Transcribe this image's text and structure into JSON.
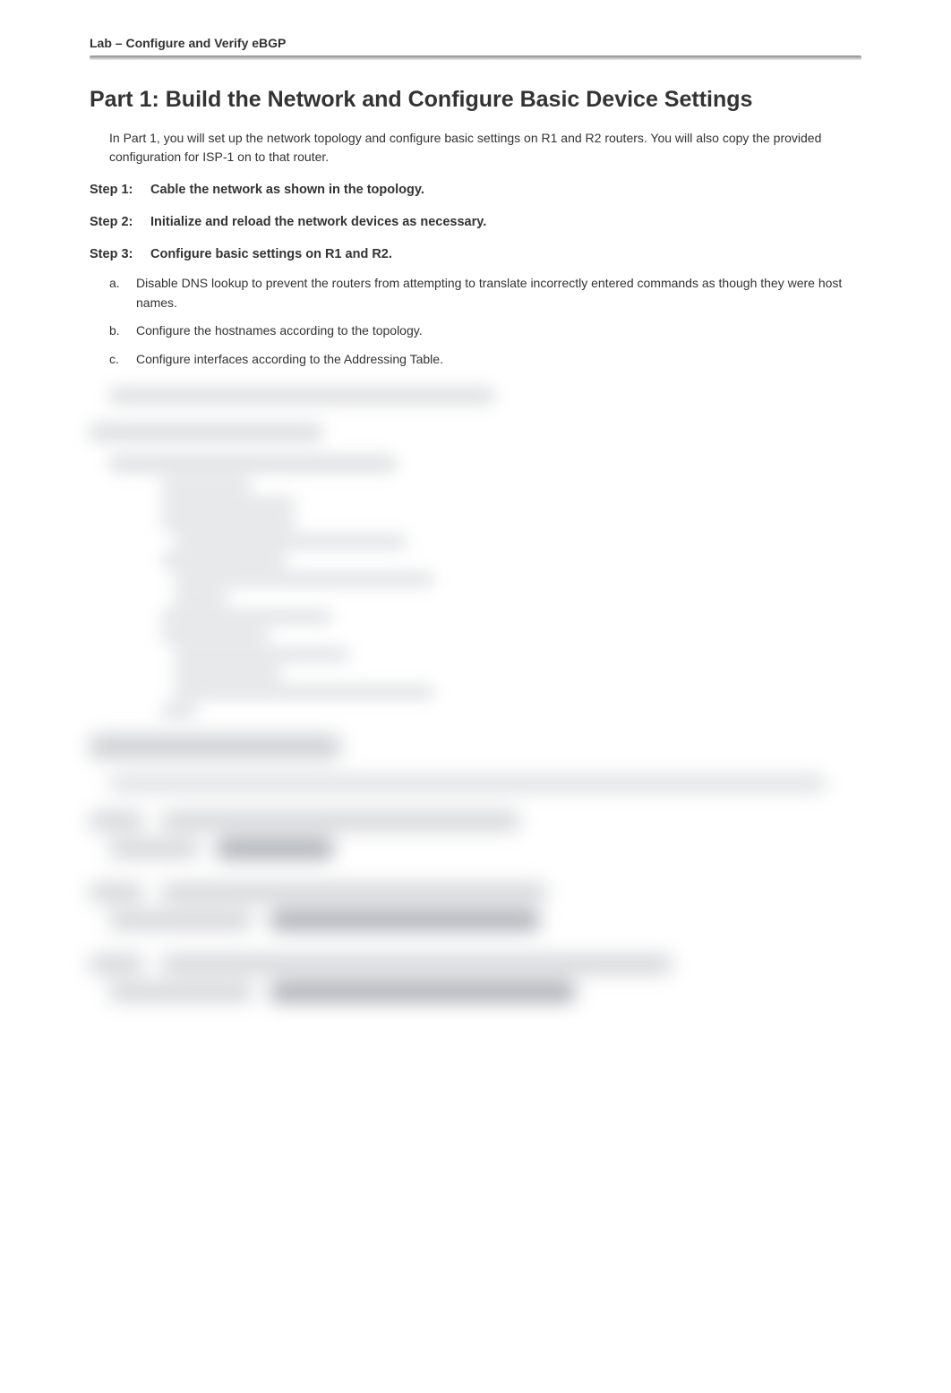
{
  "header": "Lab – Configure and Verify eBGP",
  "part1": {
    "title": "Part 1: Build the Network and Configure Basic Device Settings",
    "intro": "In Part 1, you will set up the network topology and configure basic settings on R1 and R2 routers. You will also copy the provided configuration for ISP-1 on to that router."
  },
  "steps": {
    "s1": {
      "num": "Step 1:",
      "title": "Cable the network as shown in the topology."
    },
    "s2": {
      "num": "Step 2:",
      "title": "Initialize and reload the network devices as necessary."
    },
    "s3": {
      "num": "Step 3:",
      "title": "Configure basic settings on R1 and R2."
    }
  },
  "s3list": {
    "a": {
      "letter": "a.",
      "text": "Disable DNS lookup to prevent the routers from attempting to translate incorrectly entered commands as though they were host names."
    },
    "b": {
      "letter": "b.",
      "text": "Configure the hostnames according to the topology."
    },
    "c": {
      "letter": "c.",
      "text": "Configure interfaces according to the Addressing Table."
    }
  }
}
